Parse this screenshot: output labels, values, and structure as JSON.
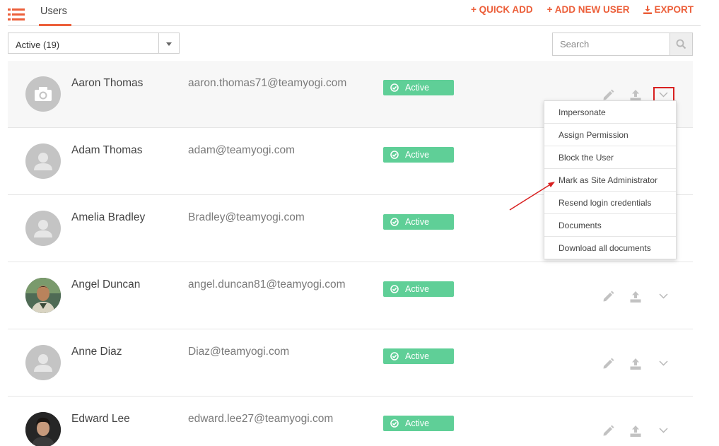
{
  "header": {
    "tab_label": "Users",
    "actions": [
      {
        "label": "+ QUICK ADD"
      },
      {
        "label": "+ ADD NEW USER"
      },
      {
        "label": "EXPORT"
      }
    ]
  },
  "filter": {
    "selected": "Active (19)"
  },
  "search": {
    "placeholder": "Search"
  },
  "users": [
    {
      "name": "Aaron Thomas",
      "email": "aaron.thomas71@teamyogi.com",
      "status": "Active",
      "avatar": "camera-placeholder"
    },
    {
      "name": "Adam Thomas",
      "email": "adam@teamyogi.com",
      "status": "Active",
      "avatar": "person-placeholder"
    },
    {
      "name": "Amelia Bradley",
      "email": "Bradley@teamyogi.com",
      "status": "Active",
      "avatar": "person-placeholder"
    },
    {
      "name": "Angel Duncan",
      "email": "angel.duncan81@teamyogi.com",
      "status": "Active",
      "avatar": "photo"
    },
    {
      "name": "Anne Diaz",
      "email": "Diaz@teamyogi.com",
      "status": "Active",
      "avatar": "person-placeholder"
    },
    {
      "name": "Edward Lee",
      "email": "edward.lee27@teamyogi.com",
      "status": "Active",
      "avatar": "photo"
    }
  ],
  "dropdown_menu": {
    "items": [
      "Impersonate",
      "Assign Permission",
      "Block the User",
      "Mark as Site Administrator",
      "Resend login credentials",
      "Documents",
      "Download all documents"
    ]
  },
  "colors": {
    "accent": "#ec5f3a",
    "status_active": "#5fcf97",
    "annotation": "#d82020"
  },
  "icons": [
    "list-menu-icon",
    "download-icon",
    "search-icon",
    "check-circle-icon",
    "pencil-icon",
    "upload-icon",
    "chevron-down-icon"
  ]
}
